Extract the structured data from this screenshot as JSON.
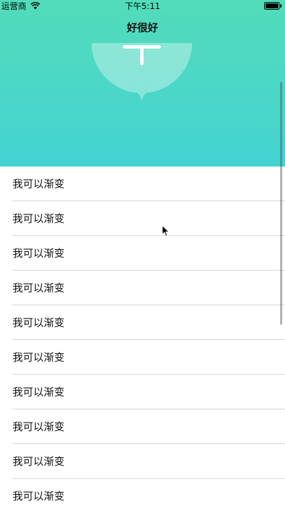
{
  "status_bar": {
    "carrier": "运营商",
    "time": "下午5:11",
    "wifi_icon": "wifi-icon",
    "battery_icon": "battery-icon"
  },
  "nav": {
    "title": "好很好"
  },
  "header": {
    "badge_icon": "pull-handle-icon",
    "gradient_top": "#52dcba",
    "gradient_bottom": "#44d3d3"
  },
  "list": {
    "items": [
      {
        "label": "我可以渐变"
      },
      {
        "label": "我可以渐变"
      },
      {
        "label": "我可以渐变"
      },
      {
        "label": "我可以渐变"
      },
      {
        "label": "我可以渐变"
      },
      {
        "label": "我可以渐变"
      },
      {
        "label": "我可以渐变"
      },
      {
        "label": "我可以渐变"
      },
      {
        "label": "我可以渐变"
      },
      {
        "label": "我可以渐变"
      }
    ]
  }
}
